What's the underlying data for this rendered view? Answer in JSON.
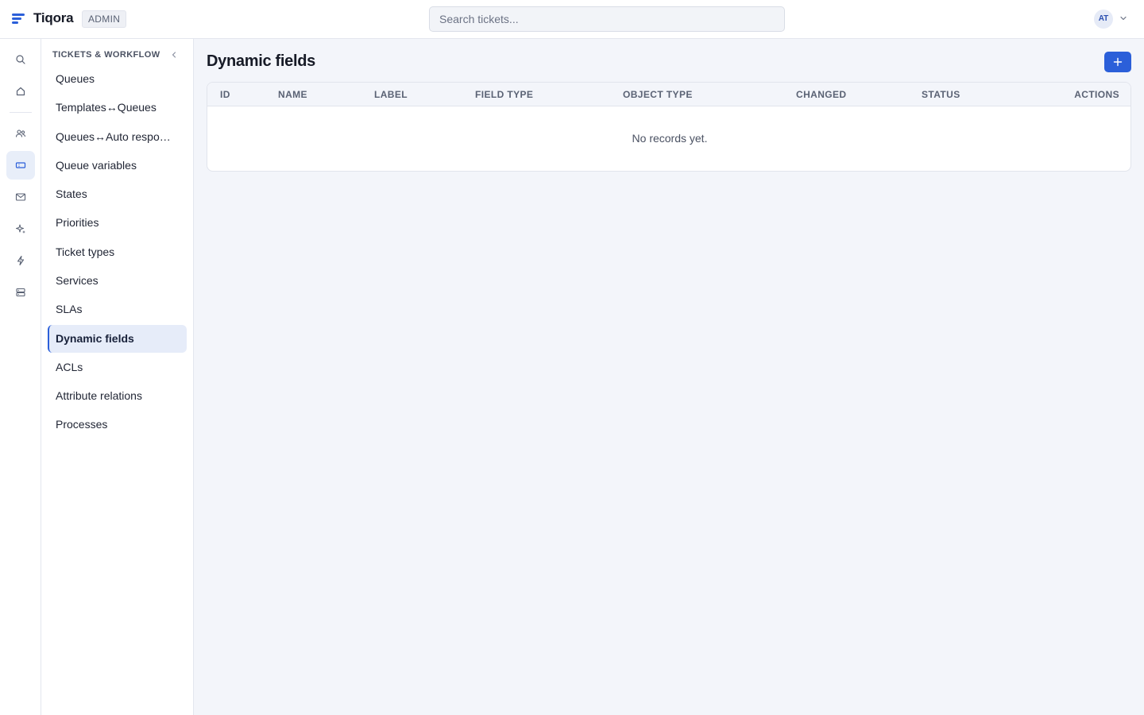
{
  "app": {
    "brand": "Tiqora",
    "badge": "ADMIN",
    "user_initials": "AT",
    "accent_color": "#2b5fd9"
  },
  "search": {
    "placeholder": "Search tickets...",
    "value": ""
  },
  "rail": {
    "items": [
      {
        "icon": "search-icon",
        "active": false
      },
      {
        "icon": "home-icon",
        "active": false
      },
      {
        "icon": "users-icon",
        "active": false
      },
      {
        "icon": "ticket-icon",
        "active": true
      },
      {
        "icon": "mail-icon",
        "active": false
      },
      {
        "icon": "sparkles-icon",
        "active": false
      },
      {
        "icon": "bolt-icon",
        "active": false
      },
      {
        "icon": "server-icon",
        "active": false
      }
    ]
  },
  "subnav": {
    "title": "TICKETS & WORKFLOW",
    "items": [
      {
        "label": "Queues"
      },
      {
        "label": "Templates↔Queues"
      },
      {
        "label": "Queues↔Auto responses"
      },
      {
        "label": "Queue variables"
      },
      {
        "label": "States"
      },
      {
        "label": "Priorities"
      },
      {
        "label": "Ticket types"
      },
      {
        "label": "Services"
      },
      {
        "label": "SLAs"
      },
      {
        "label": "Dynamic fields",
        "active": true
      },
      {
        "label": "ACLs"
      },
      {
        "label": "Attribute relations"
      },
      {
        "label": "Processes"
      }
    ]
  },
  "main": {
    "title": "Dynamic fields",
    "add_icon": "plus-icon",
    "table": {
      "columns": [
        "ID",
        "NAME",
        "LABEL",
        "FIELD TYPE",
        "OBJECT TYPE",
        "CHANGED",
        "STATUS",
        "ACTIONS"
      ],
      "rows": [],
      "empty_text": "No records yet."
    }
  }
}
